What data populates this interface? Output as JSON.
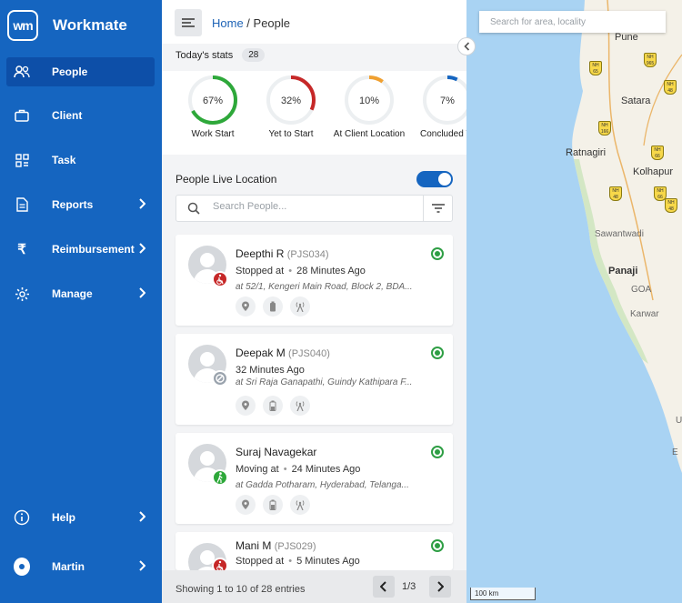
{
  "app": {
    "logo_text": "wm",
    "name": "Workmate"
  },
  "sidebar": {
    "items": [
      {
        "label": "People",
        "icon": "people-icon",
        "active": true
      },
      {
        "label": "Client",
        "icon": "briefcase-icon"
      },
      {
        "label": "Task",
        "icon": "task-icon"
      },
      {
        "label": "Reports",
        "icon": "report-icon",
        "chevron": true
      },
      {
        "label": "Reimbursement",
        "icon": "rupee-icon",
        "chevron": true
      },
      {
        "label": "Manage",
        "icon": "gear-icon",
        "chevron": true
      }
    ],
    "help_label": "Help",
    "user_label": "Martin"
  },
  "breadcrumb": {
    "home": "Home",
    "separator": " / ",
    "current": "People"
  },
  "stats": {
    "title": "Today's stats",
    "count": "28",
    "items": [
      {
        "label": "Work Start",
        "value": "67%",
        "percent": 67,
        "color": "#2ea83a"
      },
      {
        "label": "Yet to Start",
        "value": "32%",
        "percent": 32,
        "color": "#c62828"
      },
      {
        "label": "At Client Location",
        "value": "10%",
        "percent": 10,
        "color": "#f0a030"
      },
      {
        "label": "Concluded W",
        "value": "7%",
        "percent": 7,
        "color": "#1565c0"
      }
    ]
  },
  "live_location": {
    "label": "People Live Location",
    "enabled": true
  },
  "search": {
    "placeholder": "Search People..."
  },
  "people": [
    {
      "name": "Deepthi R",
      "id": "(PJS034)",
      "status": "Stopped at",
      "time": "28 Minutes Ago",
      "address": "at 52/1, Kengeri Main Road, Block 2, BDA...",
      "status_color": "#c62828",
      "status_icon": "wheelchair-icon"
    },
    {
      "name": "Deepak M",
      "id": "(PJS040)",
      "status": "",
      "time": "32 Minutes Ago",
      "address": "at Sri Raja Ganapathi, Guindy Kathipara F...",
      "status_color": "#9aa3ad",
      "status_icon": "blocked-icon"
    },
    {
      "name": "Suraj Navagekar",
      "id": "",
      "status": "Moving at",
      "time": "24 Minutes Ago",
      "address": "at Gadda Potharam, Hyderabad, Telanga...",
      "status_color": "#2ea83a",
      "status_icon": "walking-icon"
    },
    {
      "name": "Mani M",
      "id": "(PJS029)",
      "status": "Stopped at",
      "time": "5 Minutes Ago",
      "address": "",
      "status_color": "#c62828",
      "status_icon": "wheelchair-icon"
    }
  ],
  "footer": {
    "entries_text": "Showing 1 to 10 of 28 entries",
    "page": "1/3"
  },
  "map": {
    "search_placeholder": "Search for area, locality",
    "scale_label": "100 km",
    "labels": [
      {
        "text": "Pune",
        "style": "normal"
      },
      {
        "text": "Satara",
        "style": "normal"
      },
      {
        "text": "Ratnagiri",
        "style": "normal"
      },
      {
        "text": "Kolhapur",
        "style": "normal"
      },
      {
        "text": "Sawantwadi",
        "style": "faint"
      },
      {
        "text": "Panaji",
        "style": "bold"
      },
      {
        "text": "GOA",
        "style": "faint"
      },
      {
        "text": "Karwar",
        "style": "faint"
      },
      {
        "text": "U",
        "style": "faint"
      },
      {
        "text": "E",
        "style": "faint"
      }
    ],
    "shields": [
      "NH 65",
      "NH 965",
      "NH 48",
      "NH 166",
      "NH 66",
      "NH 48",
      "NH 66",
      "NH 48"
    ]
  }
}
